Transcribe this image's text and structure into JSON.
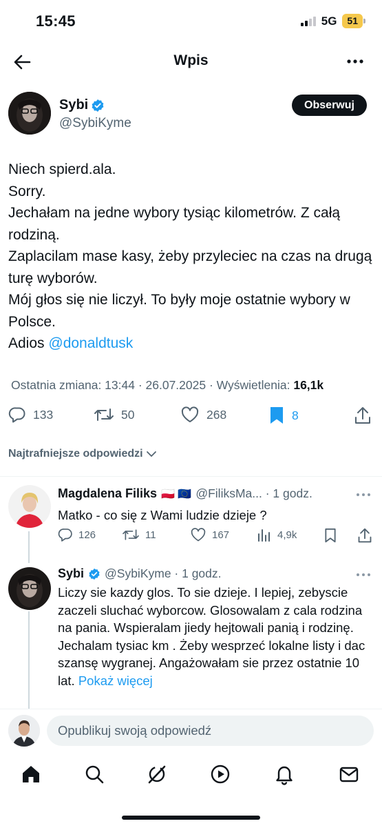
{
  "status_bar": {
    "time": "15:45",
    "network": "5G",
    "battery": "51"
  },
  "header": {
    "title": "Wpis"
  },
  "tweet": {
    "author_name": "Sybi",
    "author_handle": "@SybiKyme",
    "follow_label": "Obserwuj",
    "lines": [
      "Niech spierd.ala.",
      "Sorry.",
      "Jechałam na jedne wybory tysiąc kilometrów. Z całą rodziną.",
      "Zaplacilam mase kasy, żeby przyleciec na czas na drugą turę wyborów.",
      "Mój głos się nie liczył. To były moje ostatnie wybory w Polsce."
    ],
    "last_line_prefix": "Adios ",
    "mention": "@donaldtusk",
    "meta_prefix": "Ostatnia zmiana: 13:44 · 26.07.2025 · Wyświetlenia: ",
    "views": "16,1k",
    "replies": "133",
    "reposts": "50",
    "likes": "268",
    "bookmarks": "8"
  },
  "best_replies_label": "Najtrafniejsze odpowiedzi",
  "replies": [
    {
      "name": "Magdalena Filiks",
      "flags": "🇵🇱 🇪🇺",
      "handle_time": "@FiliksMa... · 1 godz.",
      "text": "Matko - co się z Wami ludzie dzieje ?",
      "replies": "126",
      "reposts": "11",
      "likes": "167",
      "views": "4,9k"
    },
    {
      "name": "Sybi",
      "handle_time": "@SybiKyme · 1 godz.",
      "text": "Liczy sie kazdy glos. To sie dzieje. I lepiej, zebyscie zaczeli sluchać wyborcow. Glosowalam z cala rodzina na pania. Wspieralam jiedy hejtowali panią i rodzinę. Jechalam tysiac km . Żeby wesprzeć lokalne listy i dac szansę wygranej. Angażowałam sie przez ostatnie 10 lat. ",
      "show_more": "Pokaż więcej"
    }
  ],
  "compose": {
    "placeholder": "Opublikuj swoją odpowiedź"
  },
  "colors": {
    "accent": "#1d9bf0",
    "text": "#0f1419",
    "secondary": "#536471",
    "battery": "#f5c84c"
  },
  "tabs": [
    "home-icon",
    "search-icon",
    "grok-icon",
    "video-icon",
    "notifications-icon",
    "messages-icon"
  ]
}
